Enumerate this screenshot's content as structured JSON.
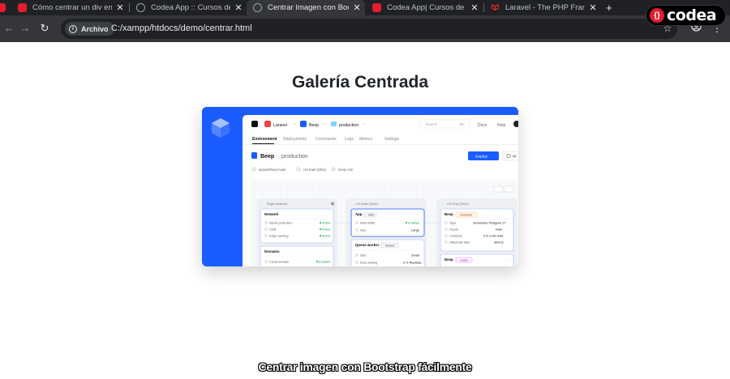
{
  "browser": {
    "tabs": [
      {
        "title": "Cómo centrar un div en B",
        "favicon_color": "#e11d2e",
        "active": false
      },
      {
        "title": "Codea App :: Cursos de p",
        "favicon_color": "#9aa0a6",
        "active": false
      },
      {
        "title": "Centrar Imagen con Boot",
        "favicon_color": "#9aa0a6",
        "active": true
      },
      {
        "title": "Codea App| Cursos de p",
        "favicon_color": "#e11d2e",
        "active": false
      },
      {
        "title": "Laravel - The PHP Frame",
        "favicon_color": "#ff2d20",
        "active": false
      }
    ],
    "new_tab_label": "+",
    "address": {
      "chip_label": "Archivo",
      "url": "C:/xampp/htdocs/demo/centrar.html"
    }
  },
  "watermark": {
    "text": "codea"
  },
  "page": {
    "heading": "Galería Centrada",
    "caption": "Centrar imagen con Bootstrap fácilmente"
  },
  "screenshot": {
    "breadcrumb": {
      "org": "Laravel",
      "app": "Beep",
      "env": "production"
    },
    "search_placeholder": "Search",
    "search_shortcut": "⌘K",
    "top_links": [
      "Docs",
      "Help"
    ],
    "nav_tabs": [
      "Environment",
      "Deployments",
      "Commands",
      "Logs",
      "Metrics",
      "Settings"
    ],
    "title_app": "Beep",
    "title_sep": "·",
    "title_env": "production",
    "deploy_label": "Deploy",
    "view_label": "Vi",
    "meta": [
      "laravel/beep-main",
      "US East (Ohio)",
      "beep.com"
    ],
    "columns": [
      {
        "header": "Edge Network"
      },
      {
        "header": "US East (Ohio)"
      },
      {
        "header": "US East (Ohio)"
      }
    ],
    "network_card": {
      "title": "Network",
      "rows": [
        {
          "label": "DDoS protection",
          "value": "Active"
        },
        {
          "label": "CDN",
          "value": "Active"
        },
        {
          "label": "Edge caching",
          "value": "Active"
        }
      ]
    },
    "domains_card": {
      "title": "Domains",
      "rows": [
        {
          "label": "Cloud domain",
          "value": "Enabled"
        }
      ]
    },
    "app_card": {
      "title": "App",
      "badge": "Web",
      "rows": [
        {
          "label": "Web traffic",
          "value": "Enabled"
        },
        {
          "label": "Size",
          "value": "Large"
        }
      ]
    },
    "queue_card": {
      "title": "Queue worker",
      "badge": "Worker",
      "rows": [
        {
          "label": "Size",
          "value": "Small"
        },
        {
          "label": "Auto scaling",
          "value": "2–4 Replicas"
        }
      ]
    },
    "db_card": {
      "title": "Beep",
      "badge": "Database",
      "rows": [
        {
          "label": "Type",
          "value": "Serverless Postgres 17"
        },
        {
          "label": "Vcpus",
          "value": "main"
        },
        {
          "label": "Compute",
          "value": "0.5–2.00 units"
        },
        {
          "label": "Hibernate after",
          "value": "300ms"
        }
      ]
    },
    "cache_card": {
      "title": "Beep",
      "badge": "Cache"
    }
  },
  "colors": {
    "accent": "#1a5cff",
    "active_green": "#16a34a",
    "chrome_bg": "#202124",
    "toolbar_bg": "#35363a",
    "brand_red": "#e11d2e"
  }
}
